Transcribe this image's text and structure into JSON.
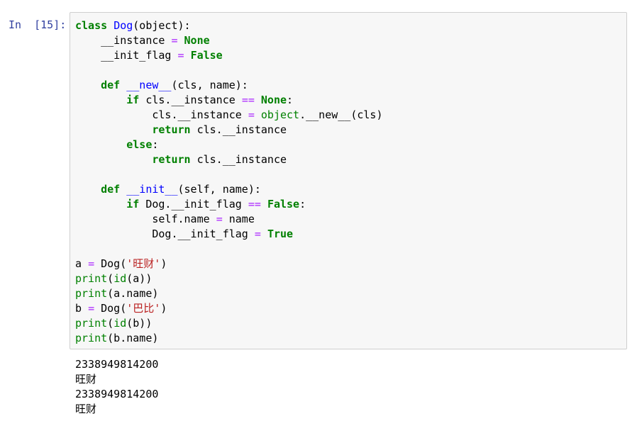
{
  "cell": {
    "prompt": "In  [15]:",
    "code_lines": [
      [
        [
          "kw",
          "class"
        ],
        [
          "t",
          " "
        ],
        [
          "cls",
          "Dog"
        ],
        [
          "t",
          "(object):"
        ]
      ],
      [
        [
          "t",
          "    __instance "
        ],
        [
          "op",
          "="
        ],
        [
          "t",
          " "
        ],
        [
          "kwc",
          "None"
        ]
      ],
      [
        [
          "t",
          "    __init_flag "
        ],
        [
          "op",
          "="
        ],
        [
          "t",
          " "
        ],
        [
          "kwc",
          "False"
        ]
      ],
      [
        [
          "t",
          ""
        ]
      ],
      [
        [
          "t",
          "    "
        ],
        [
          "kw",
          "def"
        ],
        [
          "t",
          " "
        ],
        [
          "fn",
          "__new__"
        ],
        [
          "t",
          "(cls, name):"
        ]
      ],
      [
        [
          "t",
          "        "
        ],
        [
          "kw",
          "if"
        ],
        [
          "t",
          " cls.__instance "
        ],
        [
          "op",
          "=="
        ],
        [
          "t",
          " "
        ],
        [
          "kwc",
          "None"
        ],
        [
          "t",
          ":"
        ]
      ],
      [
        [
          "t",
          "            cls.__instance "
        ],
        [
          "op",
          "="
        ],
        [
          "t",
          " "
        ],
        [
          "bi",
          "object"
        ],
        [
          "t",
          ".__new__(cls)"
        ]
      ],
      [
        [
          "t",
          "            "
        ],
        [
          "kw",
          "return"
        ],
        [
          "t",
          " cls.__instance"
        ]
      ],
      [
        [
          "t",
          "        "
        ],
        [
          "kw",
          "else"
        ],
        [
          "t",
          ":"
        ]
      ],
      [
        [
          "t",
          "            "
        ],
        [
          "kw",
          "return"
        ],
        [
          "t",
          " cls.__instance"
        ]
      ],
      [
        [
          "t",
          ""
        ]
      ],
      [
        [
          "t",
          "    "
        ],
        [
          "kw",
          "def"
        ],
        [
          "t",
          " "
        ],
        [
          "fn",
          "__init__"
        ],
        [
          "t",
          "(self, name):"
        ]
      ],
      [
        [
          "t",
          "        "
        ],
        [
          "kw",
          "if"
        ],
        [
          "t",
          " Dog.__init_flag "
        ],
        [
          "op",
          "=="
        ],
        [
          "t",
          " "
        ],
        [
          "kwc",
          "False"
        ],
        [
          "t",
          ":"
        ]
      ],
      [
        [
          "t",
          "            self.name "
        ],
        [
          "op",
          "="
        ],
        [
          "t",
          " name"
        ]
      ],
      [
        [
          "t",
          "            Dog.__init_flag "
        ],
        [
          "op",
          "="
        ],
        [
          "t",
          " "
        ],
        [
          "kwc",
          "True"
        ]
      ],
      [
        [
          "t",
          ""
        ]
      ],
      [
        [
          "t",
          "a "
        ],
        [
          "op",
          "="
        ],
        [
          "t",
          " Dog("
        ],
        [
          "str",
          "'旺财'"
        ],
        [
          "t",
          ")"
        ]
      ],
      [
        [
          "bi",
          "print"
        ],
        [
          "t",
          "("
        ],
        [
          "bi",
          "id"
        ],
        [
          "t",
          "(a))"
        ]
      ],
      [
        [
          "bi",
          "print"
        ],
        [
          "t",
          "(a.name)"
        ]
      ],
      [
        [
          "t",
          "b "
        ],
        [
          "op",
          "="
        ],
        [
          "t",
          " Dog("
        ],
        [
          "str",
          "'巴比'"
        ],
        [
          "t",
          ")"
        ]
      ],
      [
        [
          "bi",
          "print"
        ],
        [
          "t",
          "("
        ],
        [
          "bi",
          "id"
        ],
        [
          "t",
          "(b))"
        ]
      ],
      [
        [
          "bi",
          "print"
        ],
        [
          "t",
          "(b.name)"
        ]
      ]
    ],
    "output_lines": [
      "2338949814200",
      "旺财",
      "2338949814200",
      "旺财"
    ]
  },
  "colors": {
    "keyword": "#008000",
    "class_name": "#0000ff",
    "operator": "#aa22ff",
    "string": "#ba2121",
    "prompt": "#303f9f",
    "cell_background": "#f7f7f7",
    "cell_border": "#cfcfcf"
  }
}
